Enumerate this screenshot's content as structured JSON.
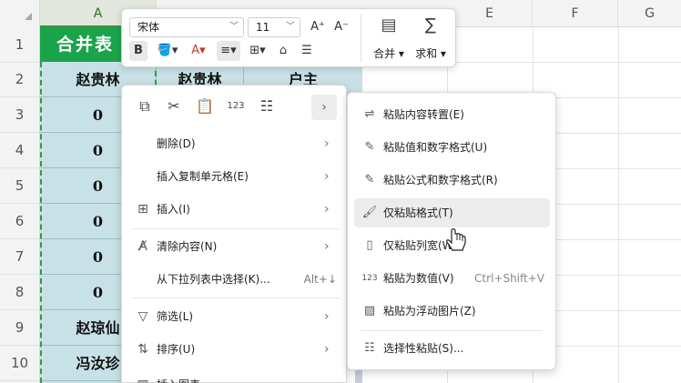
{
  "columns": [
    "A",
    "E",
    "F",
    "G"
  ],
  "rows": [
    "1",
    "2",
    "3",
    "4",
    "5",
    "6",
    "7",
    "8",
    "9",
    "10"
  ],
  "sheet": {
    "title_cell": "合并表",
    "col_a_values": [
      "赵贵林",
      "0",
      "0",
      "0",
      "0",
      "0",
      "0",
      "赵琼仙",
      "冯汝珍"
    ],
    "b2": "赵贵林",
    "c2": "户主"
  },
  "mini_toolbar": {
    "font_name": "宋体",
    "font_size": "11",
    "bold": "B",
    "merge_label": "合并",
    "sum_label": "求和"
  },
  "context_menu": {
    "items": [
      {
        "label": "删除(D)",
        "arrow": "›"
      },
      {
        "label": "插入复制单元格(E)",
        "arrow": "›"
      },
      {
        "label": "插入(I)",
        "arrow": "›"
      },
      {
        "label": "清除内容(N)",
        "arrow": "›"
      },
      {
        "label": "从下拉列表中选择(K)...",
        "shortcut": "Alt+↓"
      },
      {
        "label": "筛选(L)",
        "arrow": "›"
      },
      {
        "label": "排序(U)",
        "arrow": "›"
      },
      {
        "label": "插入图表"
      }
    ]
  },
  "paste_submenu": {
    "items": [
      {
        "label": "粘贴内容转置(E)"
      },
      {
        "label": "粘贴值和数字格式(U)"
      },
      {
        "label": "粘贴公式和数字格式(R)"
      },
      {
        "label": "仅粘贴格式(T)"
      },
      {
        "label": "仅粘贴列宽(W)"
      },
      {
        "label": "粘贴为数值(V)",
        "shortcut": "Ctrl+Shift+V"
      },
      {
        "label": "粘贴为浮动图片(Z)"
      },
      {
        "label": "选择性粘贴(S)..."
      }
    ]
  },
  "colors": {
    "title_green": "#1aa34a",
    "cell_teal": "#c8e1e6",
    "marquee": "#2d9c3e"
  }
}
